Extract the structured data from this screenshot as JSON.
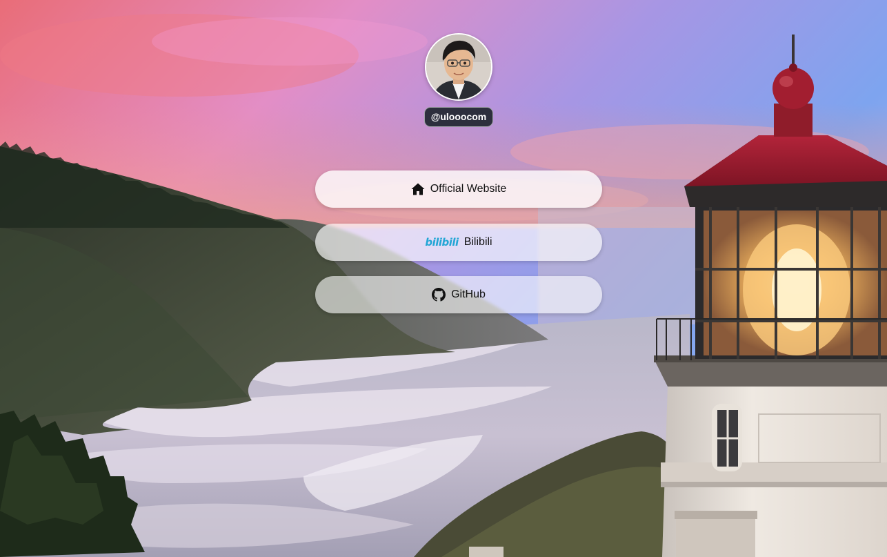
{
  "profile": {
    "username": "@ulooocom"
  },
  "links": [
    {
      "label": "Official Website",
      "icon": "home-icon"
    },
    {
      "label": "Bilibili",
      "icon": "bilibili-logo-icon",
      "logo_text": "bilibili"
    },
    {
      "label": "GitHub",
      "icon": "github-icon"
    }
  ],
  "colors": {
    "username_badge": "#2d2f3d",
    "bilibili_brand": "#23a6d5",
    "lighthouse_roof": "#9e1b2c"
  }
}
